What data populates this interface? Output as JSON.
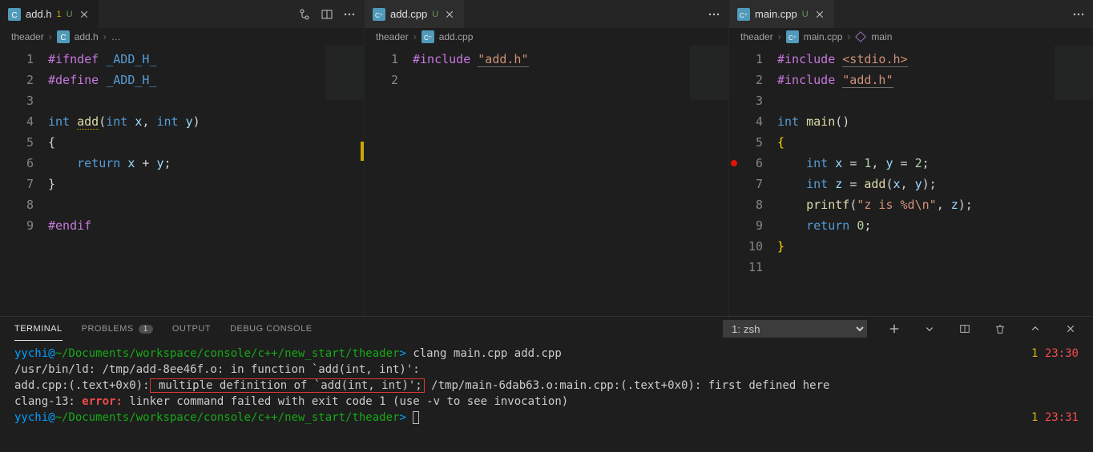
{
  "panes": [
    {
      "tab": {
        "icon": "c-file",
        "name": "add.h",
        "badge": "1",
        "mod": "U"
      },
      "breadcrumb": {
        "folder": "theader",
        "file": "add.h",
        "hasMore": true
      },
      "lines": [
        1,
        2,
        3,
        4,
        5,
        6,
        7,
        8,
        9
      ],
      "code": {
        "l1_ifndef": "#ifndef",
        "l1_macro": "_ADD_H_",
        "l2_define": "#define",
        "l2_macro": "_ADD_H_",
        "l4_int": "int",
        "l4_fn": "add",
        "l4_p1t": "int",
        "l4_p1": "x",
        "l4_p2t": "int",
        "l4_p2": "y",
        "l5": "{",
        "l6_kw": "return",
        "l6_v1": "x",
        "l6_op": "+",
        "l6_v2": "y",
        "l7": "}",
        "l9": "#endif"
      }
    },
    {
      "tab": {
        "icon": "cpp-file",
        "name": "add.cpp",
        "mod": "U"
      },
      "breadcrumb": {
        "folder": "theader",
        "file": "add.cpp"
      },
      "lines": [
        1,
        2
      ],
      "code": {
        "l1_inc": "#include",
        "l1_str": "\"add.h\""
      }
    },
    {
      "tab": {
        "icon": "cpp-file",
        "name": "main.cpp",
        "mod": "U"
      },
      "breadcrumb": {
        "folder": "theader",
        "file": "main.cpp",
        "symbol": "main"
      },
      "lines": [
        1,
        2,
        3,
        4,
        5,
        6,
        7,
        8,
        9,
        10,
        11
      ],
      "breakpointLine": 6,
      "code": {
        "l1_inc": "#include",
        "l1_hdr": "<stdio.h>",
        "l2_inc": "#include",
        "l2_hdr": "\"add.h\"",
        "l4_int": "int",
        "l4_fn": "main",
        "l5": "{",
        "l6_t": "int",
        "l6_v1": "x",
        "l6_eq": "=",
        "l6_n1": "1",
        "l6_v2": "y",
        "l6_n2": "2",
        "l7_t": "int",
        "l7_v": "z",
        "l7_fn": "add",
        "l7_a1": "x",
        "l7_a2": "y",
        "l8_fn": "printf",
        "l8_str": "\"z is %d\\n\"",
        "l8_arg": "z",
        "l9_kw": "return",
        "l9_n": "0",
        "l10": "}"
      }
    }
  ],
  "panel": {
    "tabs": {
      "terminal": "TERMINAL",
      "problems": "PROBLEMS",
      "problemsCount": "1",
      "output": "OUTPUT",
      "debug": "DEBUG CONSOLE"
    },
    "shellSelect": "1: zsh"
  },
  "terminal": {
    "promptUser": "yychi@",
    "promptPath": "~/Documents/workspace/console/c++/new_start/theader",
    "promptSep": ">",
    "cmd": "clang main.cpp add.cpp",
    "time1_status": "1",
    "time1": "23:30",
    "line2": "/usr/bin/ld: /tmp/add-8ee46f.o: in function `add(int, int)':",
    "line3_pre": "add.cpp:(.text+0x0):",
    "line3_hl": " multiple definition of `add(int, int)';",
    "line3_post": " /tmp/main-6dab63.o:main.cpp:(.text+0x0): first defined here",
    "line4_pre": "clang-13: ",
    "line4_err": "error:",
    "line4_post": " linker command failed with exit code 1 (use -v to see invocation)",
    "time2_status": "1",
    "time2": "23:31"
  }
}
